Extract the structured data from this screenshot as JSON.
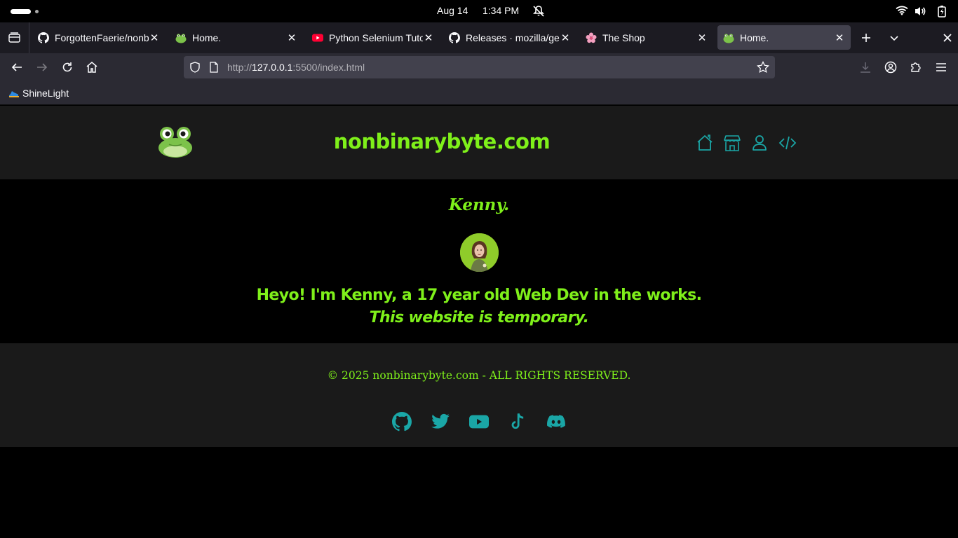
{
  "os": {
    "date": "Aug 14",
    "time": "1:34 PM"
  },
  "tabs": [
    {
      "title": "ForgottenFaerie/nonbi",
      "icon": "github-icon",
      "active": false
    },
    {
      "title": "Home.",
      "icon": "frog-icon",
      "active": false
    },
    {
      "title": "Python Selenium Tutor",
      "icon": "youtube-icon",
      "active": false
    },
    {
      "title": "Releases · mozilla/gec",
      "icon": "github-icon",
      "active": false
    },
    {
      "title": "The Shop",
      "icon": "flower-icon",
      "active": false
    },
    {
      "title": "Home.",
      "icon": "frog-icon",
      "active": true
    }
  ],
  "url": {
    "scheme": "http://",
    "host": "127.0.0.1",
    "rest": ":5500/index.html"
  },
  "bookmarks": [
    {
      "label": "ShineLight"
    }
  ],
  "site": {
    "title": "nonbinarybyte.com",
    "nav_icons": [
      "home-icon",
      "store-icon",
      "user-icon",
      "code-icon"
    ],
    "hero_name": "Kenny.",
    "hero_line1": "Heyo! I'm Kenny, a 17 year old Web Dev in the works.",
    "hero_line2": "This website is temporary.",
    "copyright": "© 2025 nonbinarybyte.com - ALL RIGHTS RESERVED.",
    "social_icons": [
      "github-icon",
      "twitter-icon",
      "youtube-icon",
      "tiktok-icon",
      "discord-icon"
    ]
  },
  "colors": {
    "accent_green": "#7ff01a",
    "icon_teal": "#1aa6a6",
    "header_bg": "#1a1a1a"
  }
}
